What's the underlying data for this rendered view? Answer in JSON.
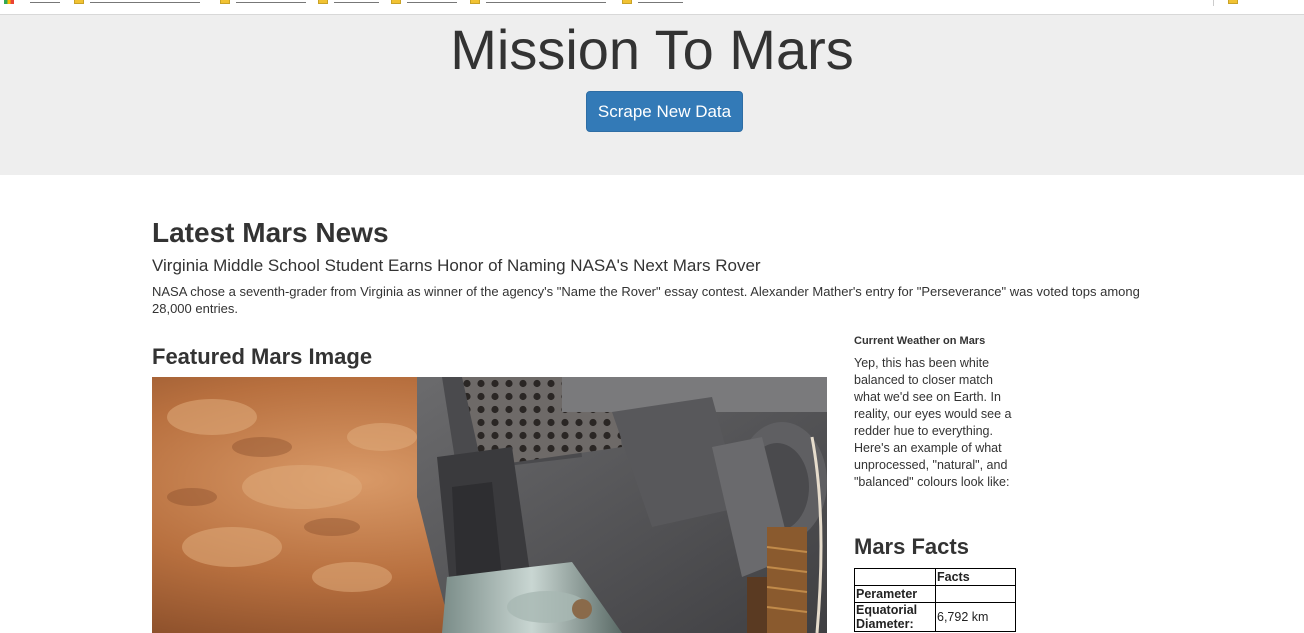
{
  "jumbotron": {
    "title": "Mission To Mars",
    "scrape_button": "Scrape New Data"
  },
  "news": {
    "heading": "Latest Mars News",
    "title": "Virginia Middle School Student Earns Honor of Naming NASA's Next Mars Rover",
    "paragraph": "NASA chose a seventh-grader from Virginia as winner of the agency's \"Name the Rover\" essay contest. Alexander Mather's entry for \"Perseverance\" was voted tops among 28,000 entries."
  },
  "featured": {
    "heading": "Featured Mars Image"
  },
  "weather": {
    "heading": "Current Weather on Mars",
    "text": "Yep, this has been white balanced to closer match what we'd see on Earth. In reality, our eyes would see a redder hue to everything. Here's an example of what unprocessed, \"natural\", and \"balanced\" colours look like:"
  },
  "facts": {
    "heading": "Mars Facts",
    "column_header": "Facts",
    "rows": [
      {
        "label": "Perameter",
        "value": ""
      },
      {
        "label": "Equatorial Diameter:",
        "value": "6,792 km"
      }
    ]
  },
  "colors": {
    "jumbotron_bg": "#eeeeee",
    "button_primary": "#337ab7",
    "text": "#333333"
  }
}
